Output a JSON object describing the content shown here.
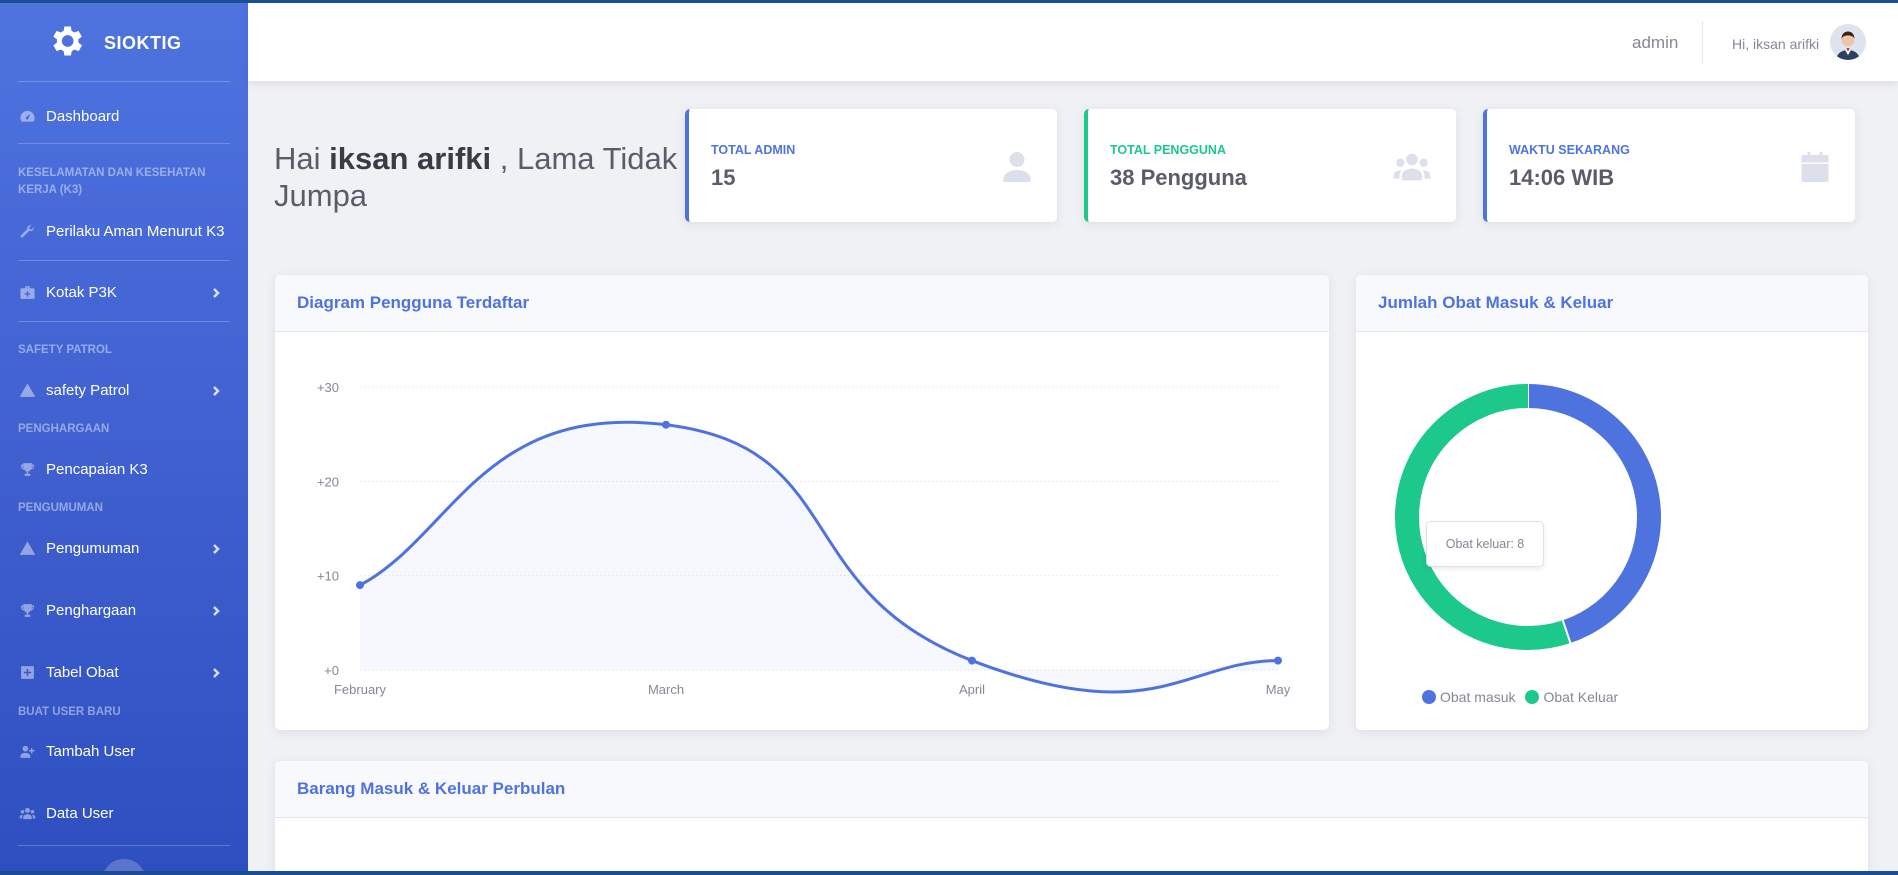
{
  "brand": {
    "name": "SIOKTIG"
  },
  "sidebar": {
    "dashboard": "Dashboard",
    "heading_k3": "KESELAMATAN DAN KESEHATAN KERJA (K3)",
    "perilaku": "Perilaku Aman Menurut K3",
    "kotak_p3k": "Kotak P3K",
    "heading_safety": "SAFETY PATROL",
    "safety_patrol": "safety Patrol",
    "heading_penghargaan": "PENGHARGAAN",
    "pencapaian": "Pencapaian K3",
    "heading_pengumuman": "PENGUMUMAN",
    "pengumuman": "Pengumuman",
    "penghargaan": "Penghargaan",
    "tabel_obat": "Tabel Obat",
    "heading_user": "BUAT USER BARU",
    "tambah_user": "Tambah User",
    "data_user": "Data User"
  },
  "topbar": {
    "admin": "admin",
    "greeting": "Hi, iksan arifki"
  },
  "greeting": {
    "prefix": "Hai",
    "name": "iksan arifki",
    "suffix": ", Lama Tidak Jumpa"
  },
  "stats": {
    "admin": {
      "label": "TOTAL ADMIN",
      "value": "15",
      "color": "#4e73df"
    },
    "pengguna": {
      "label": "TOTAL PENGGUNA",
      "value": "38 Pengguna",
      "color": "#1cc88a"
    },
    "waktu": {
      "label": "WAKTU SEKARANG",
      "value": "14:06 WIB",
      "color": "#4e73df"
    }
  },
  "cards": {
    "line_title": "Diagram Pengguna Terdaftar",
    "donut_title": "Jumlah Obat Masuk & Keluar",
    "bottom_title": "Barang Masuk & Keluar Perbulan"
  },
  "donut": {
    "tooltip": "Obat keluar: 8",
    "legend_masuk": "Obat masuk",
    "legend_keluar": "Obat Keluar"
  },
  "chart_data": [
    {
      "type": "line",
      "title": "Diagram Pengguna Terdaftar",
      "x": [
        "February",
        "March",
        "April",
        "May"
      ],
      "values": [
        9,
        26,
        1,
        1
      ],
      "yticks": [
        "+0",
        "+10",
        "+20",
        "+30"
      ],
      "ylim": [
        0,
        30
      ],
      "grid": true,
      "color": "#4e73df"
    },
    {
      "type": "pie",
      "title": "Jumlah Obat Masuk & Keluar",
      "categories": [
        "Obat masuk",
        "Obat Keluar"
      ],
      "values": [
        6.5,
        8
      ],
      "colors": [
        "#4e73df",
        "#1cc88a"
      ]
    }
  ]
}
